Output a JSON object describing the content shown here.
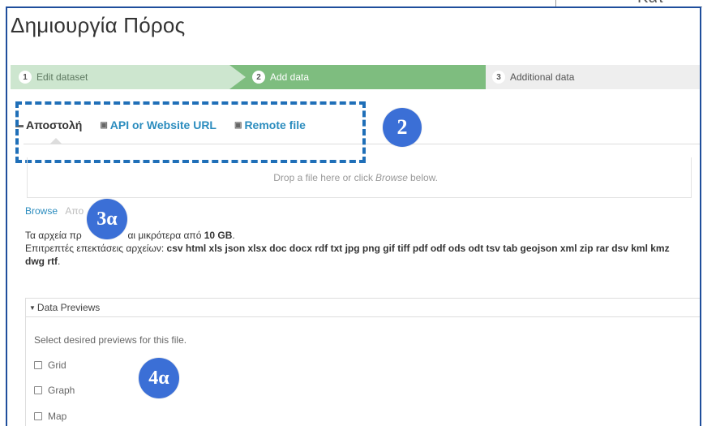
{
  "page": {
    "title": "Δημιουργία Πόρος",
    "corner_fragment": "Kατ"
  },
  "stepper": {
    "steps": [
      {
        "num": "1",
        "label": "Edit dataset"
      },
      {
        "num": "2",
        "label": "Add data"
      },
      {
        "num": "3",
        "label": "Additional data"
      }
    ]
  },
  "tabs": {
    "upload": "Αποστολή",
    "api_url": "API or Website URL",
    "remote_file": "Remote file"
  },
  "dropzone": {
    "text_before": "Drop a file here or click",
    "text_em": "Browse",
    "text_after": "below."
  },
  "browse": {
    "link": "Browse",
    "muted": "Απο"
  },
  "info": {
    "size_prefix": "Τα αρχεία πρ",
    "size_middle": "αι μικρότερα από",
    "size_value": "10 GB",
    "size_suffix": ".",
    "ext_prefix": "Επιτρεπτές επεκτάσεις αρχείων:",
    "ext_list": "csv html xls json xlsx doc docx rdf txt jpg png gif tiff pdf odf ods odt tsv tab geojson xml zip rar dsv kml kmz dwg rtf",
    "ext_suffix": "."
  },
  "previews": {
    "header": "Data Previews",
    "description": "Select desired previews for this file.",
    "options": [
      "Grid",
      "Graph",
      "Map"
    ]
  },
  "annotations": {
    "a2": "2",
    "a3": "3α",
    "a4": "4α"
  },
  "colors": {
    "frame": "#1f4e9c",
    "step_done": "#cde6cf",
    "step_active": "#7ebd7f",
    "step_pending": "#eeeeee",
    "link": "#2b8cbe",
    "annotation": "#3b6fd6"
  }
}
